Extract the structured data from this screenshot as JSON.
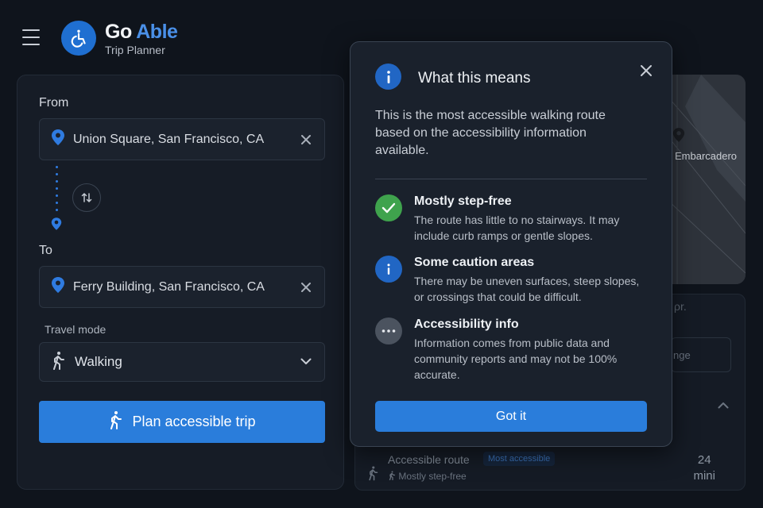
{
  "header": {
    "brand_go": "Go",
    "brand_able": "Able",
    "subtitle": "Trip Planner"
  },
  "planner": {
    "from_label": "From",
    "from_value": "Union Square, San Francisco, CA",
    "to_label": "To",
    "to_value": "Ferry Building, San Francisco, CA",
    "travel_mode_label": "Travel mode",
    "travel_mode_value": "Walking",
    "plan_button": "Plan accessible trip"
  },
  "map": {
    "place_label": "Embarcadero"
  },
  "route_list": {
    "faded_text": "ρr.",
    "faded_button": "nge",
    "item": {
      "title": "Accessible route",
      "badge": "Most accessible",
      "subtitle": "Mostly step-free",
      "duration_value": "24",
      "duration_unit": "mini"
    }
  },
  "modal": {
    "title": "What this means",
    "intro": "This is the most accessible walking route based on the accessibility information available.",
    "items": [
      {
        "icon": "check-icon",
        "color": "#3fa34d",
        "title": "Mostly step-free",
        "description": "The route has little to no stairways. It may include curb ramps or gentle slopes."
      },
      {
        "icon": "info-icon",
        "color": "#2166c4",
        "title": "Some caution areas",
        "description": "There may be uneven surfaces, steep slopes, or crossings that could be difficult."
      },
      {
        "icon": "more-icon",
        "color": "#4b535f",
        "title": "Accessibility info",
        "description": "Information comes from public data and community reports and may not be 100% accurate."
      }
    ],
    "button": "Got it"
  },
  "colors": {
    "accent": "#2a7ddb",
    "brand_blue": "#4a90e8",
    "background": "#0f141c"
  }
}
